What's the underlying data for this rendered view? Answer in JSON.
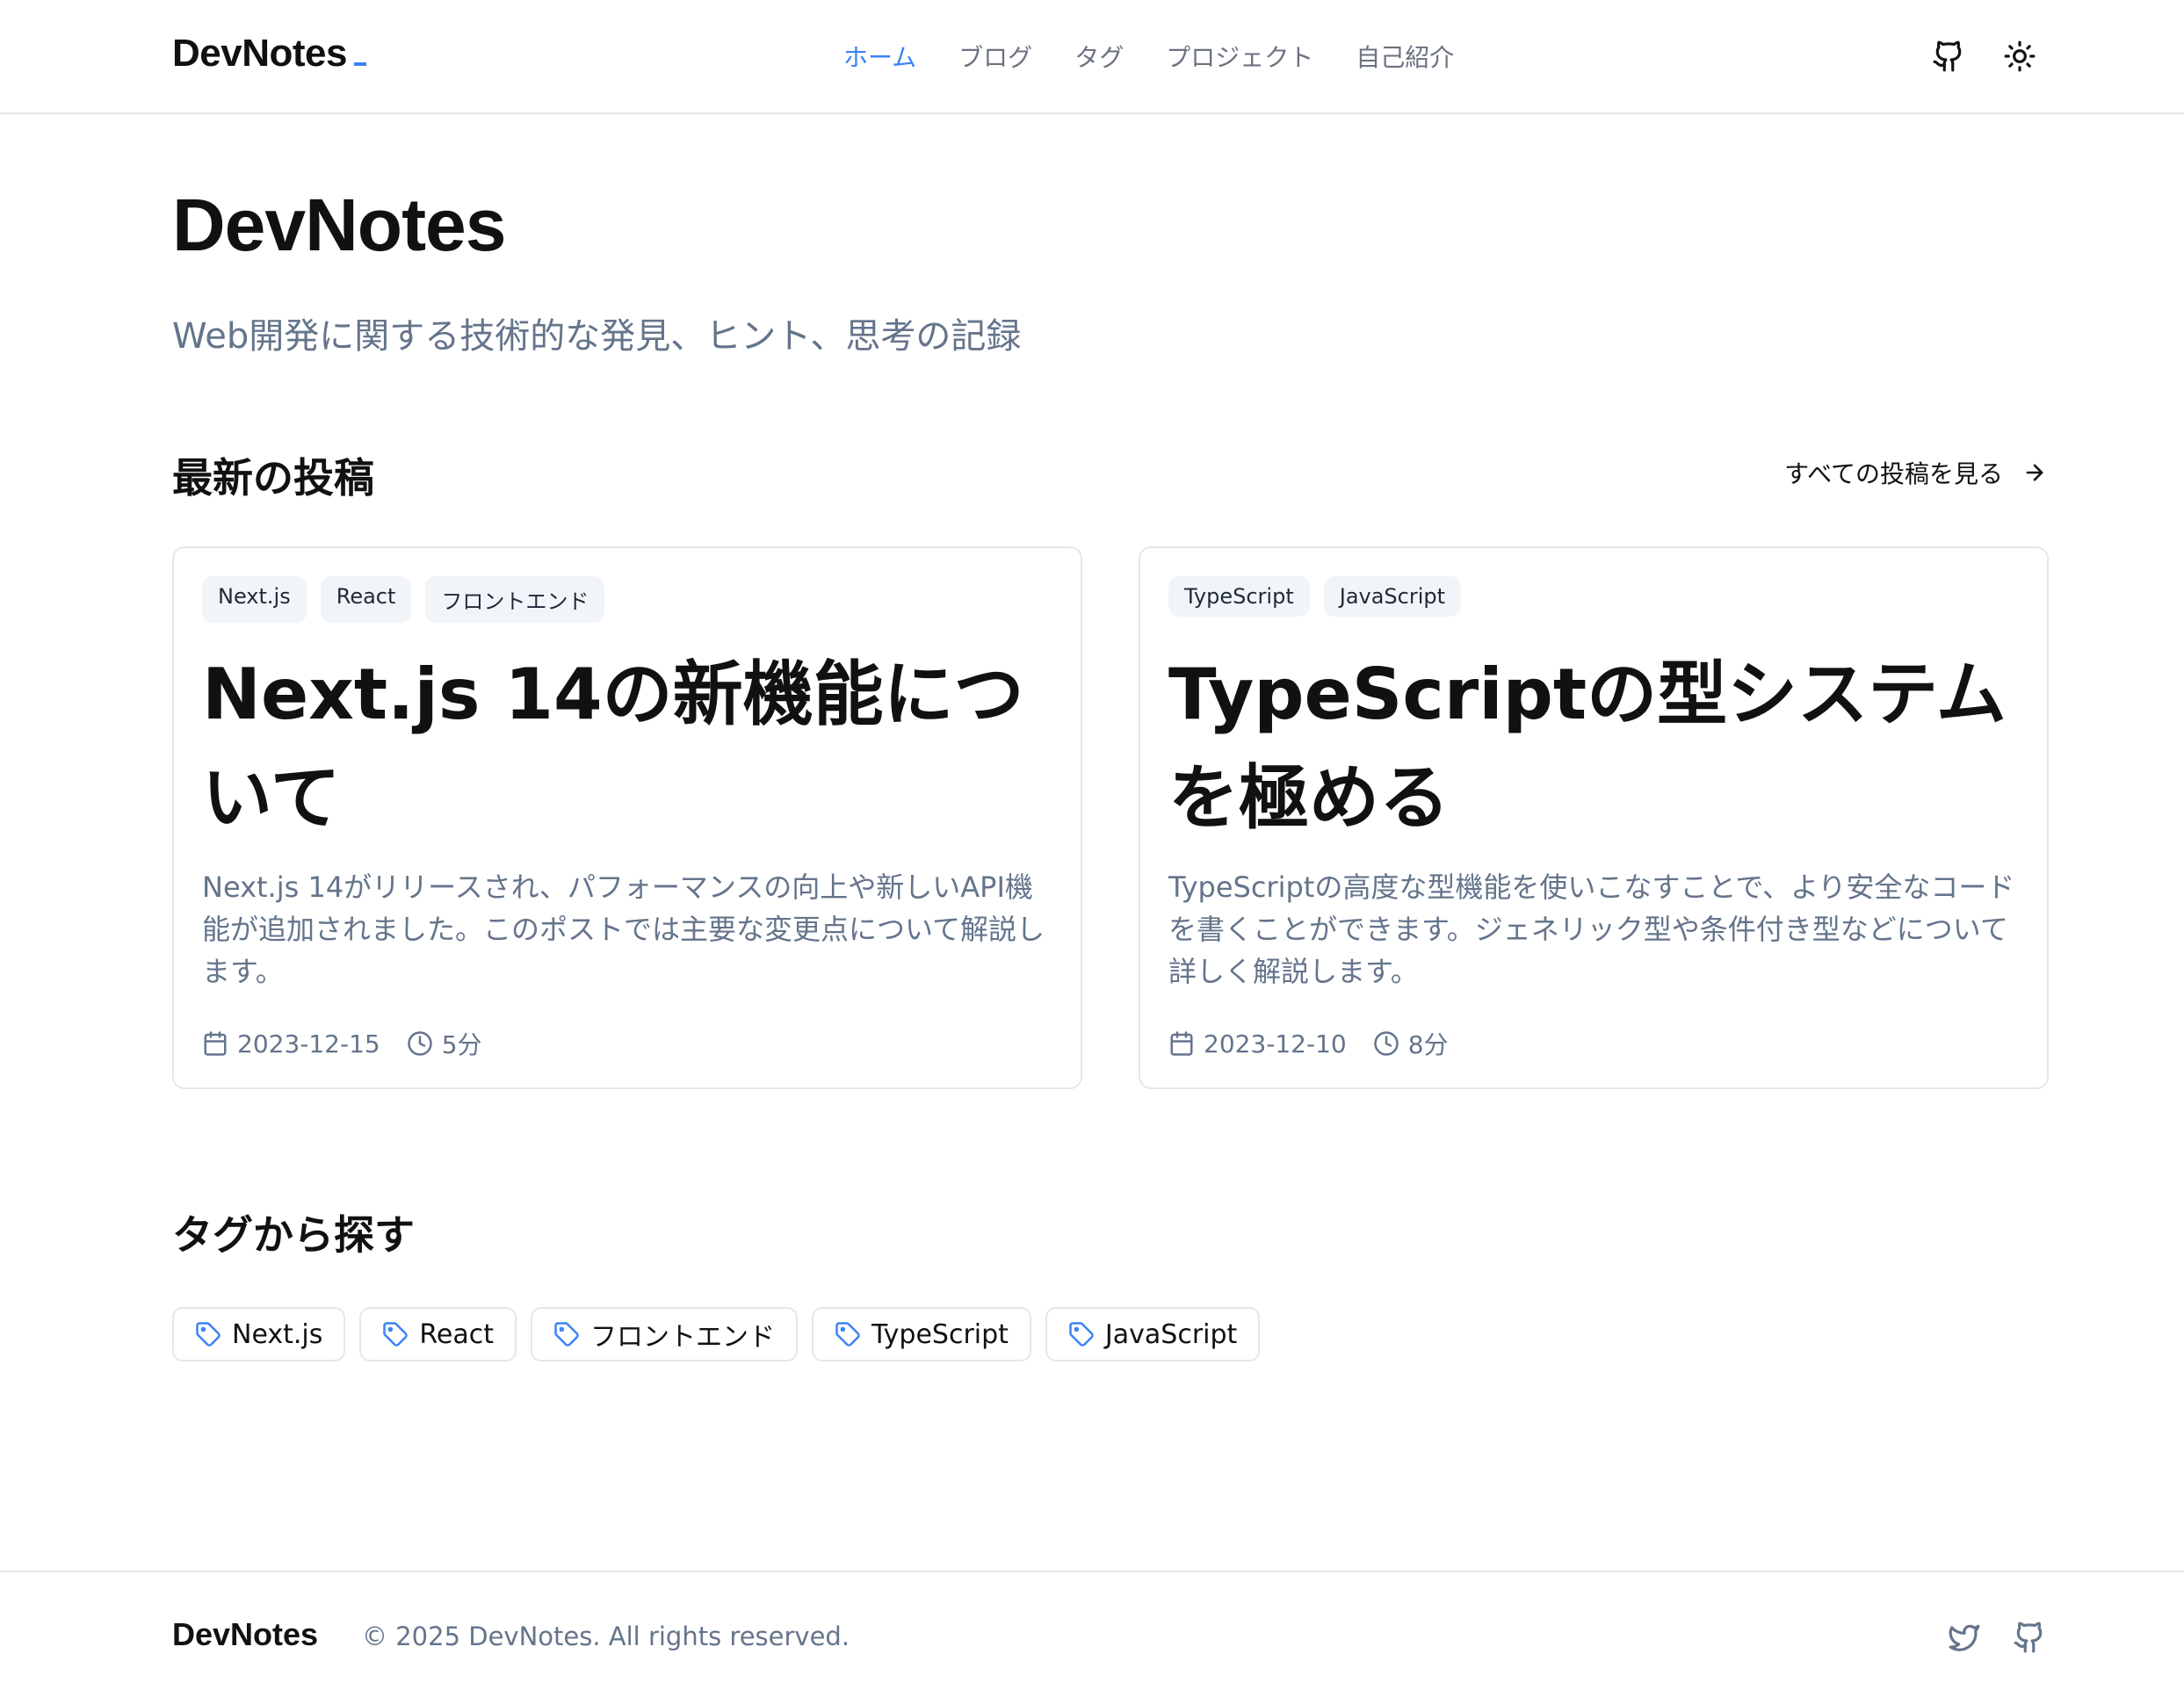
{
  "header": {
    "logo": "DevNotes",
    "nav": [
      {
        "label": "ホーム",
        "active": true
      },
      {
        "label": "ブログ",
        "active": false
      },
      {
        "label": "タグ",
        "active": false
      },
      {
        "label": "プロジェクト",
        "active": false
      },
      {
        "label": "自己紹介",
        "active": false
      }
    ],
    "icons": [
      "github-icon",
      "sun-icon"
    ]
  },
  "hero": {
    "title": "DevNotes",
    "subtitle": "Web開発に関する技術的な発見、ヒント、思考の記録"
  },
  "latest": {
    "title": "最新の投稿",
    "see_all": "すべての投稿を見る",
    "posts": [
      {
        "tags": [
          "Next.js",
          "React",
          "フロントエンド"
        ],
        "title": "Next.js 14の新機能について",
        "excerpt": "Next.js 14がリリースされ、パフォーマンスの向上や新しいAPI機能が追加されました。このポストでは主要な変更点について解説します。",
        "date": "2023-12-15",
        "read_time": "5分"
      },
      {
        "tags": [
          "TypeScript",
          "JavaScript"
        ],
        "title": "TypeScriptの型システムを極める",
        "excerpt": "TypeScriptの高度な型機能を使いこなすことで、より安全なコードを書くことができます。ジェネリック型や条件付き型などについて詳しく解説します。",
        "date": "2023-12-10",
        "read_time": "8分"
      }
    ]
  },
  "tags_section": {
    "title": "タグから探す",
    "tags": [
      "Next.js",
      "React",
      "フロントエンド",
      "TypeScript",
      "JavaScript"
    ]
  },
  "footer": {
    "logo": "DevNotes",
    "copyright": "© 2025 DevNotes. All rights reserved.",
    "icons": [
      "twitter-icon",
      "github-icon"
    ]
  },
  "colors": {
    "accent": "#3b82f6",
    "text": "#111111",
    "muted": "#64748b",
    "border": "#e5e7eb",
    "tag_bg": "#f1f5f9"
  }
}
